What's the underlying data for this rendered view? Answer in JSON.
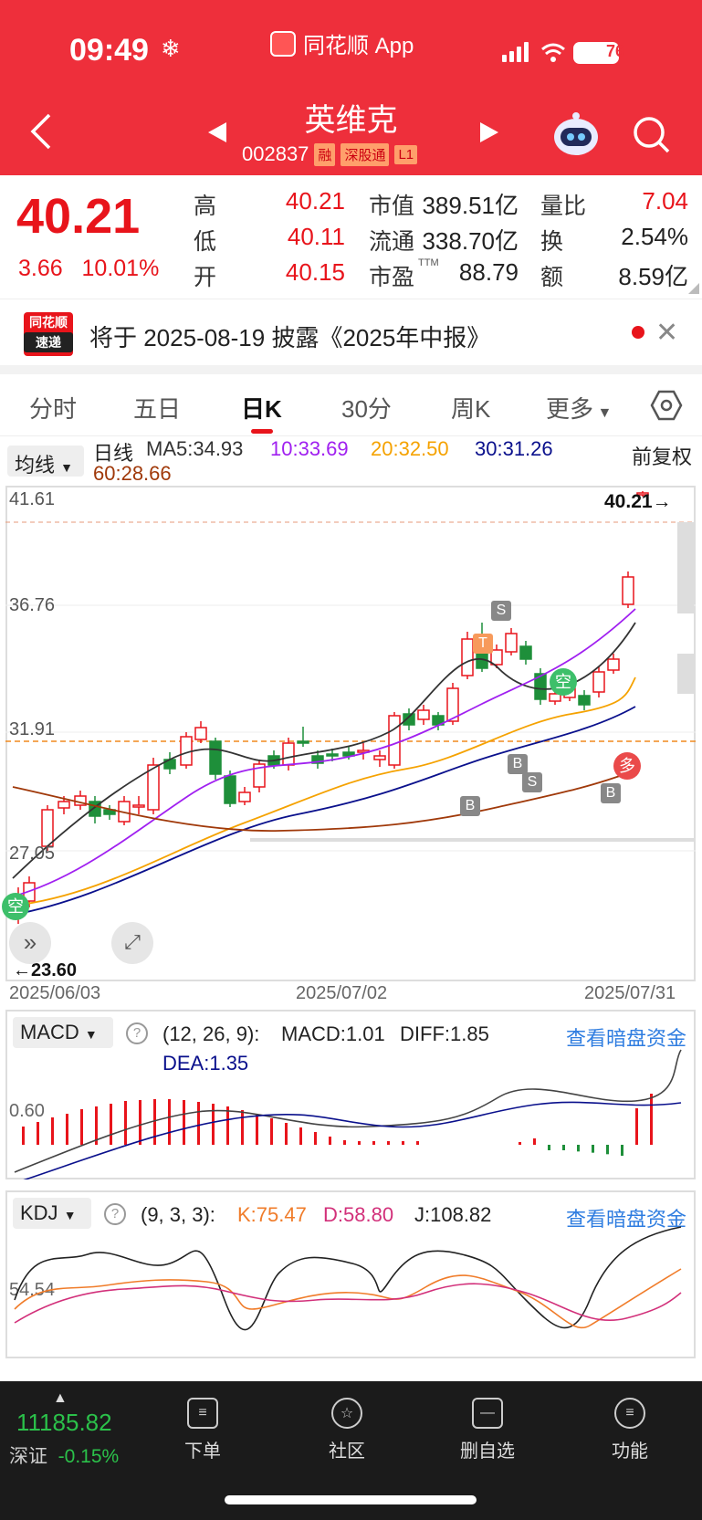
{
  "status": {
    "time": "09:49",
    "battery": "76"
  },
  "app": {
    "name": "同花顺 App"
  },
  "stock": {
    "name": "英维克",
    "code": "002837",
    "tags": [
      "融",
      "深股通",
      "L1"
    ]
  },
  "quote": {
    "price": "40.21",
    "change": "3.66",
    "change_pct": "10.01%",
    "high_label": "高",
    "high": "40.21",
    "low_label": "低",
    "low": "40.11",
    "open_label": "开",
    "open": "40.15",
    "mktcap_label": "市值",
    "mktcap": "389.51亿",
    "float_label": "流通",
    "float": "338.70亿",
    "pe_label": "市盈",
    "pe_sup": "TTM",
    "pe": "88.79",
    "vr_label": "量比",
    "vr": "7.04",
    "turn_label": "换",
    "turn": "2.54%",
    "amt_label": "额",
    "amt": "8.59亿"
  },
  "notice": {
    "logo_top": "同花顺",
    "logo_bottom": "速递",
    "text": "将于 2025-08-19 披露《2025年中报》"
  },
  "tabs": [
    "分时",
    "五日",
    "日K",
    "30分",
    "周K",
    "更多"
  ],
  "ma": {
    "selector": "均线",
    "kind": "日线",
    "ma5": "MA5:34.93",
    "ma10": "10:33.69",
    "ma20": "20:32.50",
    "ma30": "30:31.26",
    "ma60": "60:28.66",
    "fq": "前复权"
  },
  "kline": {
    "axis_labels": [
      "41.61",
      "36.76",
      "31.91",
      "27.05",
      "23.60"
    ],
    "max_marker": "40.21→",
    "min_marker": "←23.60",
    "dates": [
      "2025/06/03",
      "2025/07/02",
      "2025/07/31"
    ],
    "signals": [
      "空",
      "空",
      "多",
      "S",
      "S",
      "B",
      "B",
      "B",
      "T"
    ]
  },
  "macd": {
    "selector": "MACD",
    "params": "(12, 26, 9):",
    "macd": "MACD:1.01",
    "diff": "DIFF:1.85",
    "dea": "DEA:1.35",
    "axis": "0.60",
    "link": "查看暗盘资金"
  },
  "kdj": {
    "selector": "KDJ",
    "params": "(9, 3, 3):",
    "k": "K:75.47",
    "d": "D:58.80",
    "j": "J:108.82",
    "axis": "54.54",
    "link": "查看暗盘资金"
  },
  "bottom": {
    "index_value": "11185.82",
    "index_name": "深证",
    "index_change": "-0.15%",
    "items": [
      "下单",
      "社区",
      "删自选",
      "功能"
    ]
  },
  "colors": {
    "header": "#ee2f3b",
    "up": "#e8141b",
    "down": "#1e8f3a"
  }
}
